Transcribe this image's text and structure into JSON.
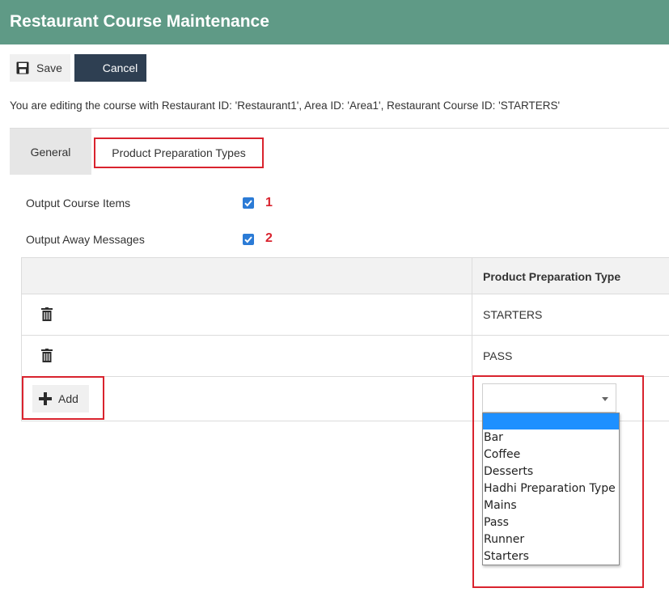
{
  "header": {
    "title": "Restaurant Course Maintenance",
    "color": "#5f9a86"
  },
  "toolbar": {
    "save_label": "Save",
    "cancel_label": "Cancel",
    "save_icon": "floppy-disk-icon"
  },
  "info_text": "You are editing the course with Restaurant ID: 'Restaurant1', Area ID: 'Area1', Restaurant Course ID: 'STARTERS'",
  "tabs": [
    {
      "label": "General"
    },
    {
      "label": "Product Preparation Types"
    }
  ],
  "fields": [
    {
      "label": "Output Course Items",
      "checked": true,
      "annotation": "1"
    },
    {
      "label": "Output Away Messages",
      "checked": true,
      "annotation": "2"
    }
  ],
  "table": {
    "column_header": "Product Preparation Type",
    "rows": [
      {
        "value": "STARTERS",
        "icon": "trash-icon"
      },
      {
        "value": "PASS",
        "icon": "trash-icon"
      }
    ],
    "add_label": "Add"
  },
  "select": {
    "value": "",
    "options": [
      "",
      "Bar",
      "Coffee",
      "Desserts",
      "Hadhi Preparation Type",
      "Mains",
      "Pass",
      "Runner",
      "Starters"
    ]
  },
  "colors": {
    "highlight": "#d9232e",
    "checkbox": "#2b7bd6",
    "selected_option": "#1e90ff"
  }
}
